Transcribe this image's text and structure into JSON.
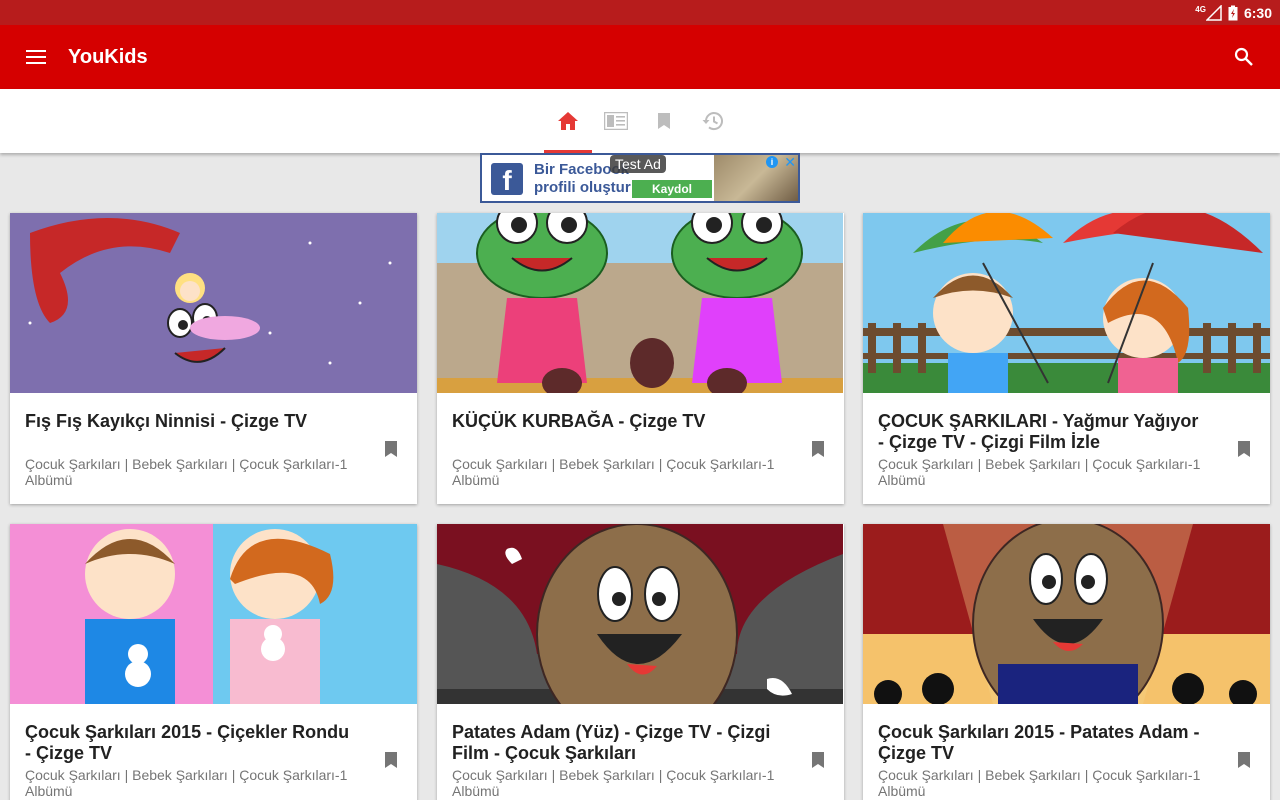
{
  "status_bar": {
    "network": "4G",
    "time": "6:30"
  },
  "app_bar": {
    "title": "YouKids",
    "menu_icon": "menu-icon",
    "search_icon": "search-icon"
  },
  "tabs": [
    {
      "icon": "home-icon",
      "active": true
    },
    {
      "icon": "news-icon",
      "active": false
    },
    {
      "icon": "bookmark-icon",
      "active": false
    },
    {
      "icon": "history-icon",
      "active": false
    }
  ],
  "ad": {
    "test_label": "Test Ad",
    "line1": "Bir Facebook",
    "line2": "profili oluştur",
    "button": "Kaydol",
    "logo_letter": "f",
    "choices": "i",
    "close": "✕"
  },
  "videos": [
    {
      "title": "Fış Fış Kayıkçı Ninnisi - Çizge TV",
      "subtitle": "Çocuk Şarkıları | Bebek Şarkıları | Çocuk Şarkıları-1 Albümü"
    },
    {
      "title": "KÜÇÜK KURBAĞA - Çizge TV",
      "subtitle": "Çocuk Şarkıları | Bebek Şarkıları | Çocuk Şarkıları-1 Albümü"
    },
    {
      "title": "ÇOCUK ŞARKILARI - Yağmur Yağıyor - Çizge TV - Çizgi Film İzle",
      "subtitle": "Çocuk Şarkıları | Bebek Şarkıları | Çocuk Şarkıları-1 Albümü"
    },
    {
      "title": "Çocuk Şarkıları 2015 - Çiçekler Rondu - Çizge TV",
      "subtitle": "Çocuk Şarkıları | Bebek Şarkıları | Çocuk Şarkıları-1 Albümü"
    },
    {
      "title": "Patates Adam (Yüz) - Çizge TV - Çizgi Film - Çocuk Şarkıları",
      "subtitle": "Çocuk Şarkıları | Bebek Şarkıları | Çocuk Şarkıları-1 Albümü"
    },
    {
      "title": "Çocuk Şarkıları 2015 - Patates Adam - Çizge TV",
      "subtitle": "Çocuk Şarkıları | Bebek Şarkıları | Çocuk Şarkıları-1 Albümü"
    }
  ],
  "colors": {
    "status_bar": "#b71c1c",
    "app_bar": "#d50000",
    "accent": "#e53935",
    "tab_inactive": "#bdbdbd"
  }
}
